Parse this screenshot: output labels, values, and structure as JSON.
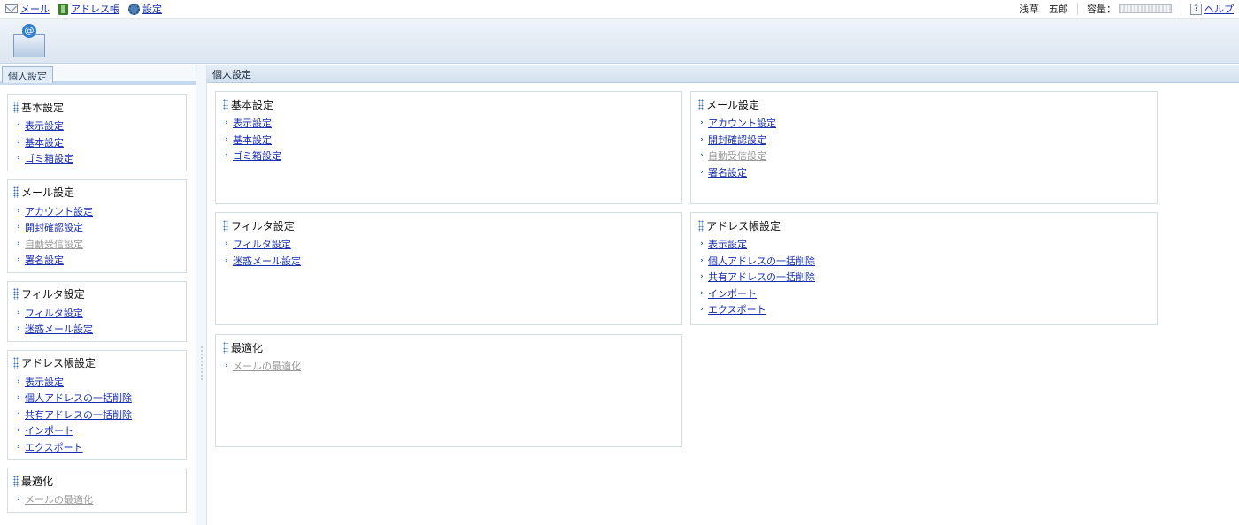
{
  "topbar": {
    "nav": [
      {
        "label": "メール",
        "icon": "mail-icon"
      },
      {
        "label": "アドレス帳",
        "icon": "address-book-icon"
      },
      {
        "label": "設定",
        "icon": "gear-icon"
      }
    ],
    "user_name": "浅草　五郎",
    "capacity_label": "容量：",
    "help_label": "ヘルプ"
  },
  "sidebar": {
    "tab_label": "個人設定",
    "sections": [
      {
        "title": "基本設定",
        "items": [
          {
            "label": "表示設定",
            "enabled": true
          },
          {
            "label": "基本設定",
            "enabled": true
          },
          {
            "label": "ゴミ箱設定",
            "enabled": true
          }
        ]
      },
      {
        "title": "メール設定",
        "items": [
          {
            "label": "アカウント設定",
            "enabled": true
          },
          {
            "label": "開封確認設定",
            "enabled": true
          },
          {
            "label": "自動受信設定",
            "enabled": false
          },
          {
            "label": "署名設定",
            "enabled": true
          }
        ]
      },
      {
        "title": "フィルタ設定",
        "items": [
          {
            "label": "フィルタ設定",
            "enabled": true
          },
          {
            "label": "迷惑メール設定",
            "enabled": true
          }
        ]
      },
      {
        "title": "アドレス帳設定",
        "items": [
          {
            "label": "表示設定",
            "enabled": true
          },
          {
            "label": "個人アドレスの一括削除",
            "enabled": true
          },
          {
            "label": "共有アドレスの一括削除",
            "enabled": true
          },
          {
            "label": "インポート",
            "enabled": true
          },
          {
            "label": "エクスポート",
            "enabled": true
          }
        ]
      },
      {
        "title": "最適化",
        "items": [
          {
            "label": "メールの最適化",
            "enabled": false
          }
        ]
      }
    ]
  },
  "main": {
    "header_title": "個人設定",
    "panels": [
      {
        "title": "基本設定",
        "items": [
          {
            "label": "表示設定",
            "enabled": true
          },
          {
            "label": "基本設定",
            "enabled": true
          },
          {
            "label": "ゴミ箱設定",
            "enabled": true
          }
        ]
      },
      {
        "title": "メール設定",
        "items": [
          {
            "label": "アカウント設定",
            "enabled": true
          },
          {
            "label": "開封確認設定",
            "enabled": true
          },
          {
            "label": "自動受信設定",
            "enabled": false
          },
          {
            "label": "署名設定",
            "enabled": true
          }
        ]
      },
      {
        "title": "フィルタ設定",
        "items": [
          {
            "label": "フィルタ設定",
            "enabled": true
          },
          {
            "label": "迷惑メール設定",
            "enabled": true
          }
        ]
      },
      {
        "title": "アドレス帳設定",
        "items": [
          {
            "label": "表示設定",
            "enabled": true
          },
          {
            "label": "個人アドレスの一括削除",
            "enabled": true
          },
          {
            "label": "共有アドレスの一括削除",
            "enabled": true
          },
          {
            "label": "インポート",
            "enabled": true
          },
          {
            "label": "エクスポート",
            "enabled": true
          }
        ]
      },
      {
        "title": "最適化",
        "items": [
          {
            "label": "メールの最適化",
            "enabled": false
          }
        ]
      }
    ]
  },
  "colors": {
    "link": "#1a2fb0",
    "disabled": "#999999",
    "accent": "#3e71b8"
  }
}
